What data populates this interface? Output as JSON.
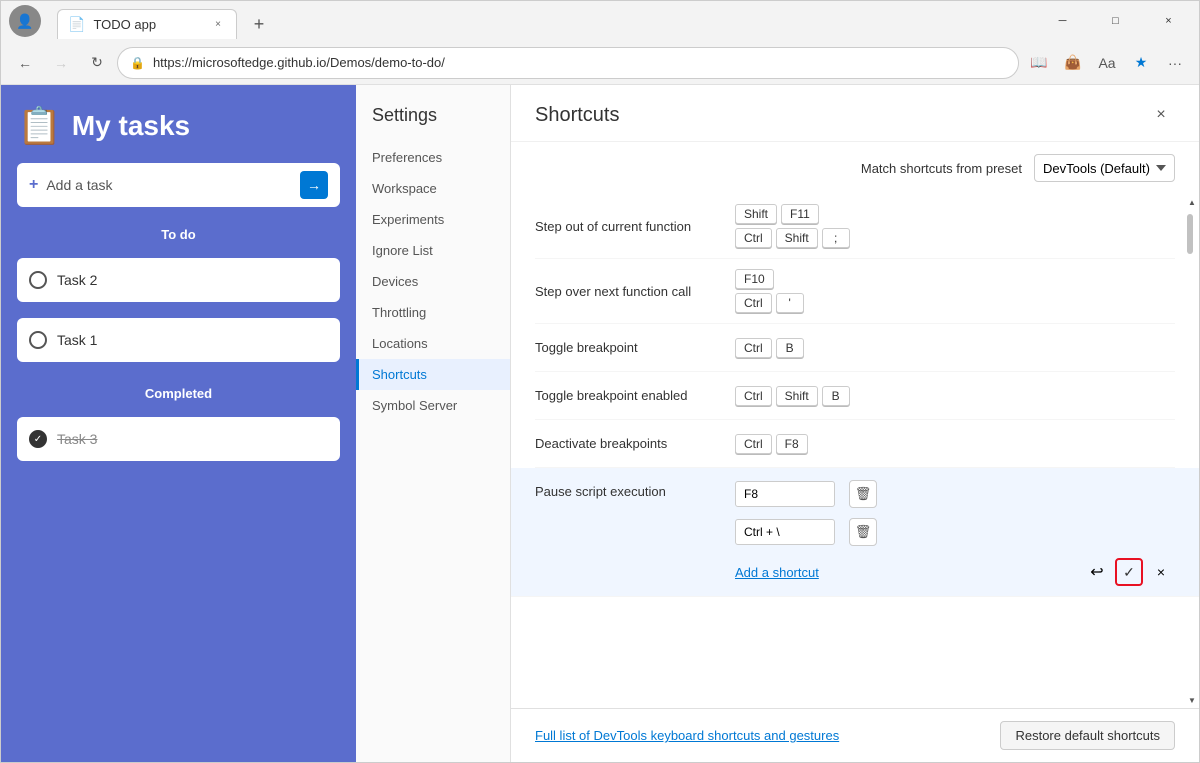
{
  "browser": {
    "tab_title": "TODO app",
    "tab_close_label": "×",
    "new_tab_label": "+",
    "address": "https://microsoftedge.github.io/Demos/demo-to-do/",
    "back_btn": "←",
    "forward_btn": "→",
    "refresh_btn": "↻",
    "lock_icon": "🔒",
    "minimize_label": "─",
    "maximize_label": "□",
    "close_label": "×",
    "more_label": "···",
    "star_label": "★"
  },
  "todo": {
    "icon": "📋",
    "title": "My tasks",
    "add_placeholder": "Add a task",
    "add_arrow": "→",
    "todo_label": "To do",
    "completed_label": "Completed",
    "tasks": [
      {
        "id": 1,
        "text": "Task 2",
        "done": false
      },
      {
        "id": 2,
        "text": "Task 1",
        "done": false
      }
    ],
    "completed_tasks": [
      {
        "id": 3,
        "text": "Task 3",
        "done": true
      }
    ]
  },
  "settings": {
    "title": "Settings",
    "nav_items": [
      {
        "label": "Preferences",
        "active": false
      },
      {
        "label": "Workspace",
        "active": false
      },
      {
        "label": "Experiments",
        "active": false
      },
      {
        "label": "Ignore List",
        "active": false
      },
      {
        "label": "Devices",
        "active": false
      },
      {
        "label": "Throttling",
        "active": false
      },
      {
        "label": "Locations",
        "active": false
      },
      {
        "label": "Shortcuts",
        "active": true
      },
      {
        "label": "Symbol Server",
        "active": false
      }
    ]
  },
  "shortcuts": {
    "title": "Shortcuts",
    "preset_label": "Match shortcuts from preset",
    "preset_value": "DevTools (Default)",
    "close_label": "×",
    "items": [
      {
        "name": "Step out of current function",
        "key_groups": [
          [
            "Shift",
            "F11"
          ],
          [
            "Ctrl",
            "Shift",
            ";"
          ]
        ],
        "active": false
      },
      {
        "name": "Step over next function call",
        "key_groups": [
          [
            "F10"
          ],
          [
            "Ctrl",
            "'"
          ]
        ],
        "active": false
      },
      {
        "name": "Toggle breakpoint",
        "key_groups": [
          [
            "Ctrl",
            "B"
          ]
        ],
        "active": false
      },
      {
        "name": "Toggle breakpoint enabled",
        "key_groups": [
          [
            "Ctrl",
            "Shift",
            "B"
          ]
        ],
        "active": false
      },
      {
        "name": "Deactivate breakpoints",
        "key_groups": [
          [
            "Ctrl",
            "F8"
          ]
        ],
        "active": false
      },
      {
        "name": "Pause script execution",
        "key_groups": [],
        "input_values": [
          "F8",
          "Ctrl + \\"
        ],
        "active": true,
        "add_shortcut_label": "Add a shortcut"
      }
    ],
    "full_list_link": "Full list of DevTools keyboard shortcuts and gestures",
    "restore_default_label": "Restore default shortcuts"
  }
}
